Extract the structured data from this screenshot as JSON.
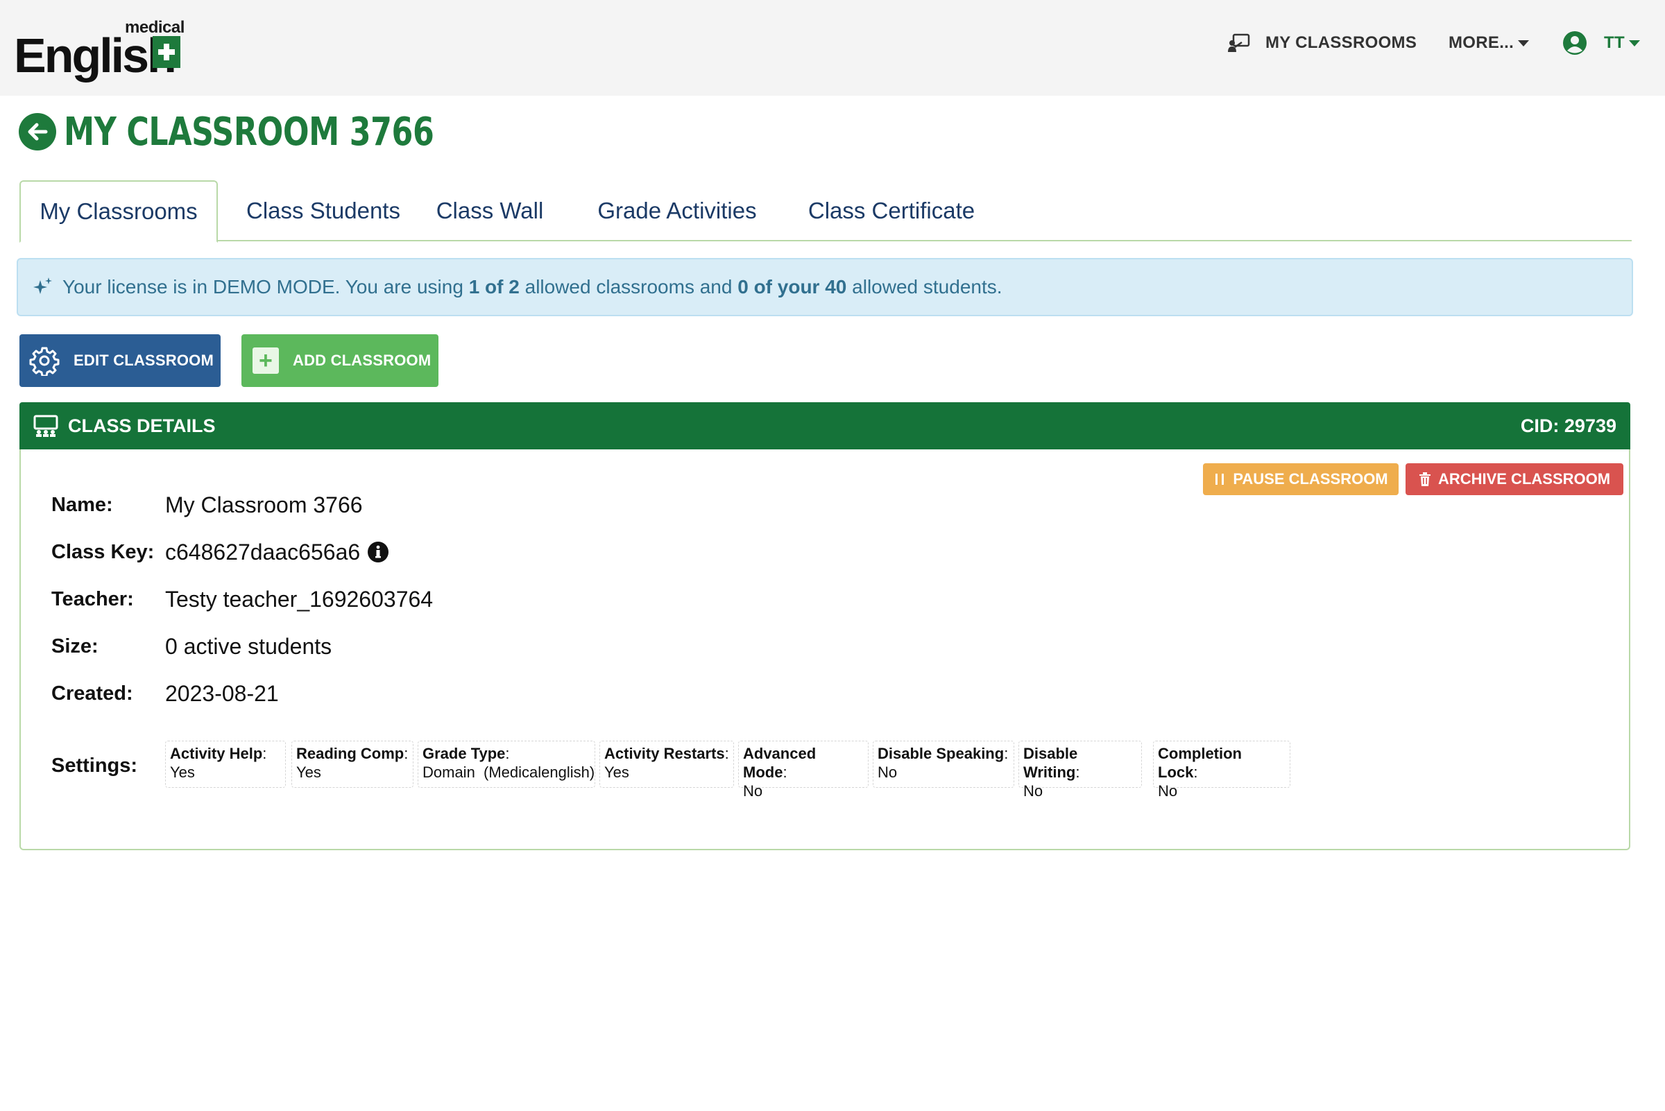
{
  "logo": {
    "small": "medical",
    "main": "English"
  },
  "nav": {
    "my_classrooms": "MY CLASSROOMS",
    "more": "MORE...",
    "user": "TT"
  },
  "page": {
    "title": "MY CLASSROOM 3766"
  },
  "tabs": [
    {
      "label": "My Classrooms",
      "active": true
    },
    {
      "label": "Class Students"
    },
    {
      "label": "Class Wall"
    },
    {
      "label": "Grade Activities"
    },
    {
      "label": "Class Certificate"
    }
  ],
  "alert": {
    "prefix": "Your license is in DEMO MODE. You are using ",
    "classrooms": "1 of 2",
    "mid": " allowed classrooms and ",
    "students": "0 of your 40",
    "suffix": " allowed students."
  },
  "buttons": {
    "edit": "EDIT CLASSROOM",
    "add": "ADD CLASSROOM"
  },
  "panel": {
    "title": "CLASS DETAILS",
    "cid": "CID: 29739",
    "pause": "PAUSE CLASSROOM",
    "archive": "ARCHIVE CLASSROOM"
  },
  "details": {
    "name": {
      "label": "Name:",
      "value": "My Classroom 3766"
    },
    "class_key": {
      "label": "Class Key:",
      "value": "c648627daac656a6"
    },
    "teacher": {
      "label": "Teacher:",
      "value": "Testy teacher_1692603764"
    },
    "size": {
      "label": "Size:",
      "value": "0 active students"
    },
    "created": {
      "label": "Created:",
      "value": "2023-08-21"
    },
    "settings_label": "Settings:"
  },
  "settings": [
    {
      "key": "Activity Help",
      "value": "Yes"
    },
    {
      "key": "Reading Comp",
      "value": "Yes"
    },
    {
      "key": "Grade Type",
      "value": "Domain  (Medicalenglish)"
    },
    {
      "key": "Activity Restarts",
      "value": "Yes"
    },
    {
      "key": "Advanced Mode",
      "value": "No"
    },
    {
      "key": "Disable Speaking",
      "value": "No"
    },
    {
      "key": "Disable Writing",
      "value": "No"
    },
    {
      "key": "Completion Lock",
      "value": "No"
    }
  ],
  "colors": {
    "brand_green": "#1e7a3c",
    "panel_green": "#157339",
    "navy": "#2b5d94",
    "alert_bg": "#d9edf7"
  }
}
